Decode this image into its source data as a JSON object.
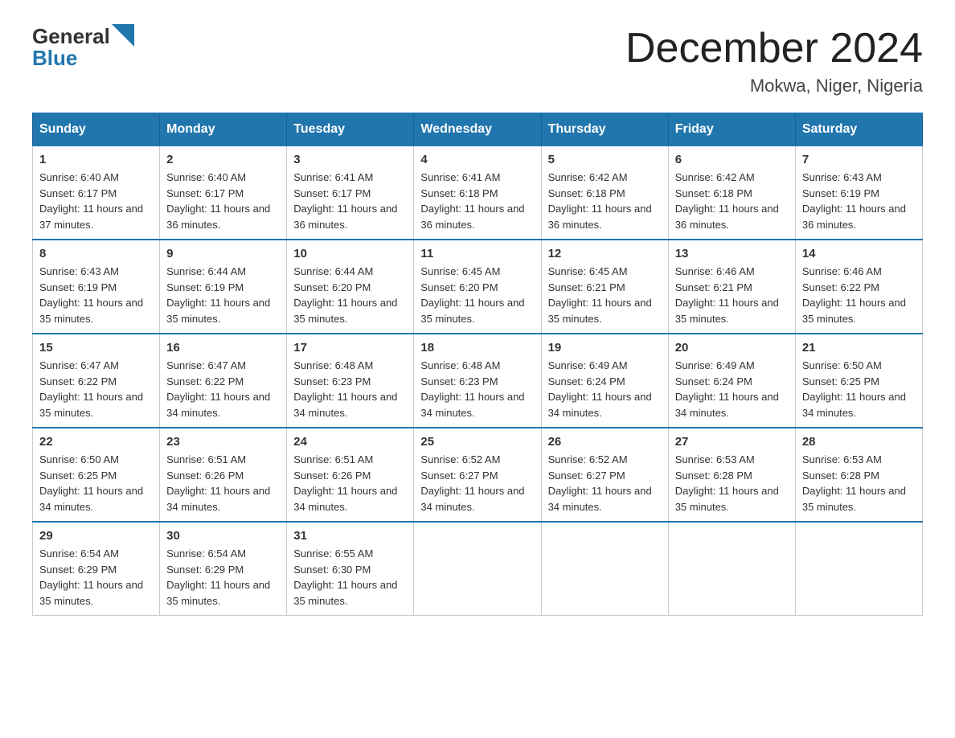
{
  "header": {
    "month_title": "December 2024",
    "location": "Mokwa, Niger, Nigeria",
    "logo_general": "General",
    "logo_blue": "Blue"
  },
  "weekdays": [
    "Sunday",
    "Monday",
    "Tuesday",
    "Wednesday",
    "Thursday",
    "Friday",
    "Saturday"
  ],
  "weeks": [
    [
      {
        "day": "1",
        "sunrise": "Sunrise: 6:40 AM",
        "sunset": "Sunset: 6:17 PM",
        "daylight": "Daylight: 11 hours and 37 minutes."
      },
      {
        "day": "2",
        "sunrise": "Sunrise: 6:40 AM",
        "sunset": "Sunset: 6:17 PM",
        "daylight": "Daylight: 11 hours and 36 minutes."
      },
      {
        "day": "3",
        "sunrise": "Sunrise: 6:41 AM",
        "sunset": "Sunset: 6:17 PM",
        "daylight": "Daylight: 11 hours and 36 minutes."
      },
      {
        "day": "4",
        "sunrise": "Sunrise: 6:41 AM",
        "sunset": "Sunset: 6:18 PM",
        "daylight": "Daylight: 11 hours and 36 minutes."
      },
      {
        "day": "5",
        "sunrise": "Sunrise: 6:42 AM",
        "sunset": "Sunset: 6:18 PM",
        "daylight": "Daylight: 11 hours and 36 minutes."
      },
      {
        "day": "6",
        "sunrise": "Sunrise: 6:42 AM",
        "sunset": "Sunset: 6:18 PM",
        "daylight": "Daylight: 11 hours and 36 minutes."
      },
      {
        "day": "7",
        "sunrise": "Sunrise: 6:43 AM",
        "sunset": "Sunset: 6:19 PM",
        "daylight": "Daylight: 11 hours and 36 minutes."
      }
    ],
    [
      {
        "day": "8",
        "sunrise": "Sunrise: 6:43 AM",
        "sunset": "Sunset: 6:19 PM",
        "daylight": "Daylight: 11 hours and 35 minutes."
      },
      {
        "day": "9",
        "sunrise": "Sunrise: 6:44 AM",
        "sunset": "Sunset: 6:19 PM",
        "daylight": "Daylight: 11 hours and 35 minutes."
      },
      {
        "day": "10",
        "sunrise": "Sunrise: 6:44 AM",
        "sunset": "Sunset: 6:20 PM",
        "daylight": "Daylight: 11 hours and 35 minutes."
      },
      {
        "day": "11",
        "sunrise": "Sunrise: 6:45 AM",
        "sunset": "Sunset: 6:20 PM",
        "daylight": "Daylight: 11 hours and 35 minutes."
      },
      {
        "day": "12",
        "sunrise": "Sunrise: 6:45 AM",
        "sunset": "Sunset: 6:21 PM",
        "daylight": "Daylight: 11 hours and 35 minutes."
      },
      {
        "day": "13",
        "sunrise": "Sunrise: 6:46 AM",
        "sunset": "Sunset: 6:21 PM",
        "daylight": "Daylight: 11 hours and 35 minutes."
      },
      {
        "day": "14",
        "sunrise": "Sunrise: 6:46 AM",
        "sunset": "Sunset: 6:22 PM",
        "daylight": "Daylight: 11 hours and 35 minutes."
      }
    ],
    [
      {
        "day": "15",
        "sunrise": "Sunrise: 6:47 AM",
        "sunset": "Sunset: 6:22 PM",
        "daylight": "Daylight: 11 hours and 35 minutes."
      },
      {
        "day": "16",
        "sunrise": "Sunrise: 6:47 AM",
        "sunset": "Sunset: 6:22 PM",
        "daylight": "Daylight: 11 hours and 34 minutes."
      },
      {
        "day": "17",
        "sunrise": "Sunrise: 6:48 AM",
        "sunset": "Sunset: 6:23 PM",
        "daylight": "Daylight: 11 hours and 34 minutes."
      },
      {
        "day": "18",
        "sunrise": "Sunrise: 6:48 AM",
        "sunset": "Sunset: 6:23 PM",
        "daylight": "Daylight: 11 hours and 34 minutes."
      },
      {
        "day": "19",
        "sunrise": "Sunrise: 6:49 AM",
        "sunset": "Sunset: 6:24 PM",
        "daylight": "Daylight: 11 hours and 34 minutes."
      },
      {
        "day": "20",
        "sunrise": "Sunrise: 6:49 AM",
        "sunset": "Sunset: 6:24 PM",
        "daylight": "Daylight: 11 hours and 34 minutes."
      },
      {
        "day": "21",
        "sunrise": "Sunrise: 6:50 AM",
        "sunset": "Sunset: 6:25 PM",
        "daylight": "Daylight: 11 hours and 34 minutes."
      }
    ],
    [
      {
        "day": "22",
        "sunrise": "Sunrise: 6:50 AM",
        "sunset": "Sunset: 6:25 PM",
        "daylight": "Daylight: 11 hours and 34 minutes."
      },
      {
        "day": "23",
        "sunrise": "Sunrise: 6:51 AM",
        "sunset": "Sunset: 6:26 PM",
        "daylight": "Daylight: 11 hours and 34 minutes."
      },
      {
        "day": "24",
        "sunrise": "Sunrise: 6:51 AM",
        "sunset": "Sunset: 6:26 PM",
        "daylight": "Daylight: 11 hours and 34 minutes."
      },
      {
        "day": "25",
        "sunrise": "Sunrise: 6:52 AM",
        "sunset": "Sunset: 6:27 PM",
        "daylight": "Daylight: 11 hours and 34 minutes."
      },
      {
        "day": "26",
        "sunrise": "Sunrise: 6:52 AM",
        "sunset": "Sunset: 6:27 PM",
        "daylight": "Daylight: 11 hours and 34 minutes."
      },
      {
        "day": "27",
        "sunrise": "Sunrise: 6:53 AM",
        "sunset": "Sunset: 6:28 PM",
        "daylight": "Daylight: 11 hours and 35 minutes."
      },
      {
        "day": "28",
        "sunrise": "Sunrise: 6:53 AM",
        "sunset": "Sunset: 6:28 PM",
        "daylight": "Daylight: 11 hours and 35 minutes."
      }
    ],
    [
      {
        "day": "29",
        "sunrise": "Sunrise: 6:54 AM",
        "sunset": "Sunset: 6:29 PM",
        "daylight": "Daylight: 11 hours and 35 minutes."
      },
      {
        "day": "30",
        "sunrise": "Sunrise: 6:54 AM",
        "sunset": "Sunset: 6:29 PM",
        "daylight": "Daylight: 11 hours and 35 minutes."
      },
      {
        "day": "31",
        "sunrise": "Sunrise: 6:55 AM",
        "sunset": "Sunset: 6:30 PM",
        "daylight": "Daylight: 11 hours and 35 minutes."
      },
      null,
      null,
      null,
      null
    ]
  ]
}
